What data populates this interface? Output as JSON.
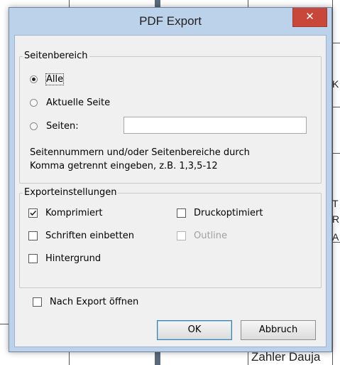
{
  "dialog": {
    "title": "PDF Export",
    "close_label": "✕"
  },
  "page_range": {
    "legend": "Seitenbereich",
    "options": [
      {
        "label": "Alle",
        "selected": true
      },
      {
        "label": "Aktuelle Seite",
        "selected": false
      },
      {
        "label": "Seiten:",
        "selected": false
      }
    ],
    "pages_input_value": "",
    "hint_line1": "Seitennummern und/oder Seitenbereiche durch",
    "hint_line2": "Komma getrennt eingeben, z.B. 1,3,5-12"
  },
  "export_settings": {
    "legend": "Exporteinstellungen",
    "compressed": {
      "label": "Komprimiert",
      "checked": true
    },
    "print_optimized": {
      "label": "Druckoptimiert",
      "checked": false
    },
    "embed_fonts": {
      "label": "Schriften einbetten",
      "checked": false
    },
    "outline": {
      "label": "Outline",
      "checked": false,
      "disabled": true
    },
    "background": {
      "label": "Hintergrund",
      "checked": false
    }
  },
  "open_after_export": {
    "label": "Nach Export öffnen",
    "checked": false
  },
  "buttons": {
    "ok": "OK",
    "cancel": "Abbruch"
  },
  "background_document": {
    "fragment_text": "Zahler Dauja",
    "edge_chars": [
      "K",
      "T",
      "A",
      "R"
    ]
  },
  "colors": {
    "frame": "#bcd1ea",
    "close_button": "#c8463a",
    "client_bg": "#f0f0f0"
  }
}
